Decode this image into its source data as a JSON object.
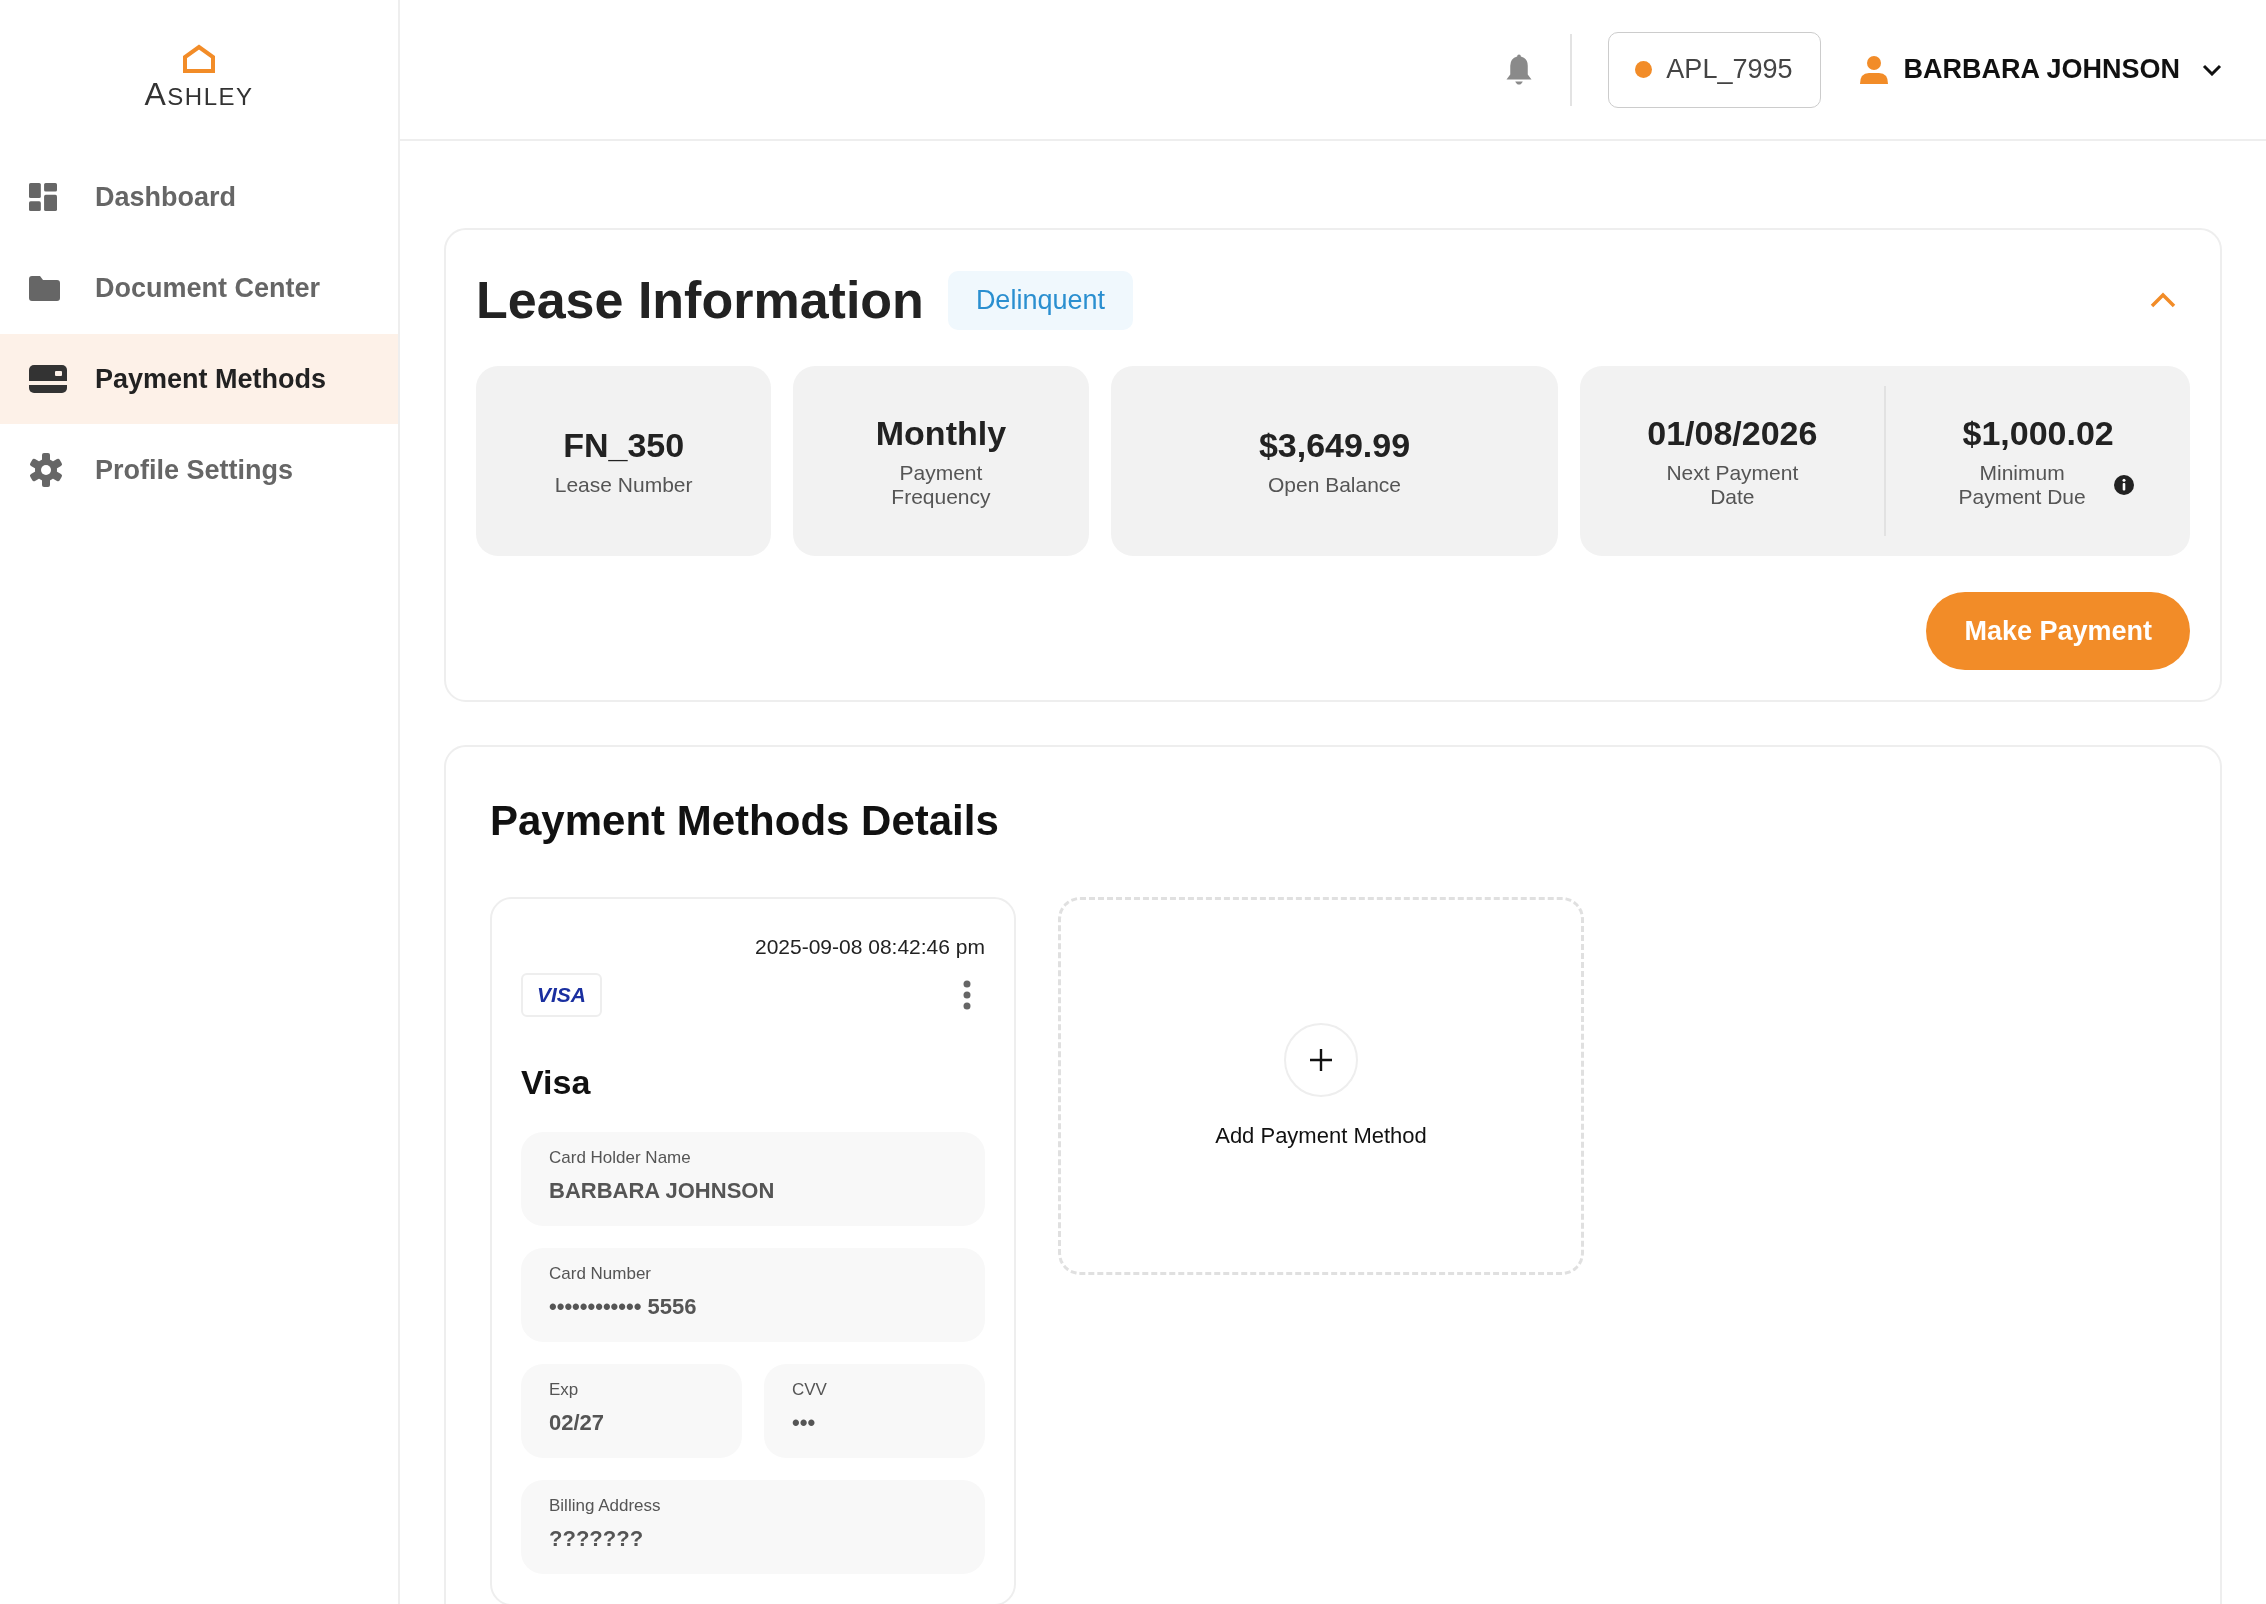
{
  "logo": {
    "text": "ASHLEY"
  },
  "sidebar": {
    "items": [
      {
        "label": "Dashboard",
        "kind": "dashboard",
        "selected": false
      },
      {
        "label": "Document Center",
        "kind": "folder",
        "selected": false
      },
      {
        "label": "Payment Methods",
        "kind": "card",
        "selected": true
      },
      {
        "label": "Profile Settings",
        "kind": "gear",
        "selected": false
      }
    ]
  },
  "header": {
    "account": "APL_7995",
    "user": "BARBARA JOHNSON"
  },
  "lease": {
    "title": "Lease Information",
    "status": "Delinquent",
    "expanded": true,
    "stats": [
      {
        "items": [
          {
            "value": "FN_350",
            "label": "Lease Number",
            "info": false
          }
        ]
      },
      {
        "items": [
          {
            "value": "Monthly",
            "label": "Payment Frequency",
            "info": false
          }
        ]
      },
      {
        "items": [
          {
            "value": "$3,649.99",
            "label": "Open Balance",
            "info": false
          }
        ]
      },
      {
        "items": [
          {
            "value": "01/08/2026",
            "label": "Next Payment Date",
            "info": false
          },
          {
            "value": "$1,000.02",
            "label": "Minimum Payment Due",
            "info": true
          }
        ]
      }
    ],
    "action": "Make Payment"
  },
  "payment_methods": {
    "title": "Payment Methods Details",
    "cards": [
      {
        "timestamp": "2025-09-08 08:42:46 pm",
        "brand": "VISA",
        "name": "Visa",
        "fields": [
          {
            "label": "Card Holder Name",
            "value": "BARBARA JOHNSON",
            "half": false
          },
          {
            "label": "Card Number",
            "value": "•••••••••••• 5556",
            "half": false
          },
          {
            "label": "Exp",
            "value": "02/27",
            "half": true
          },
          {
            "label": "CVV",
            "value": "•••",
            "half": true
          },
          {
            "label": "Billing Address",
            "value": "???????",
            "half": false
          }
        ]
      }
    ],
    "add_label": "Add Payment Method"
  }
}
